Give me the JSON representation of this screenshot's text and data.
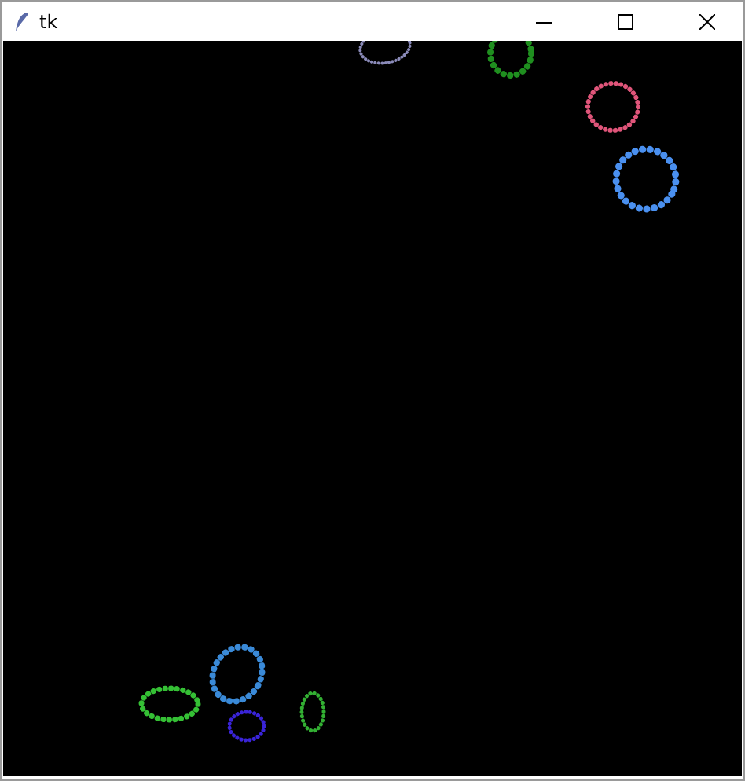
{
  "window": {
    "title": "tk"
  },
  "canvas": {
    "rings": [
      {
        "color": "#8a8ab8"
      },
      {
        "color": "#1f8f1f"
      },
      {
        "color": "#e0557a"
      },
      {
        "color": "#4a90f0"
      },
      {
        "color": "#3a8ad8"
      },
      {
        "color": "#35c035"
      },
      {
        "color": "#3a24d8"
      },
      {
        "color": "#33b033"
      }
    ]
  }
}
